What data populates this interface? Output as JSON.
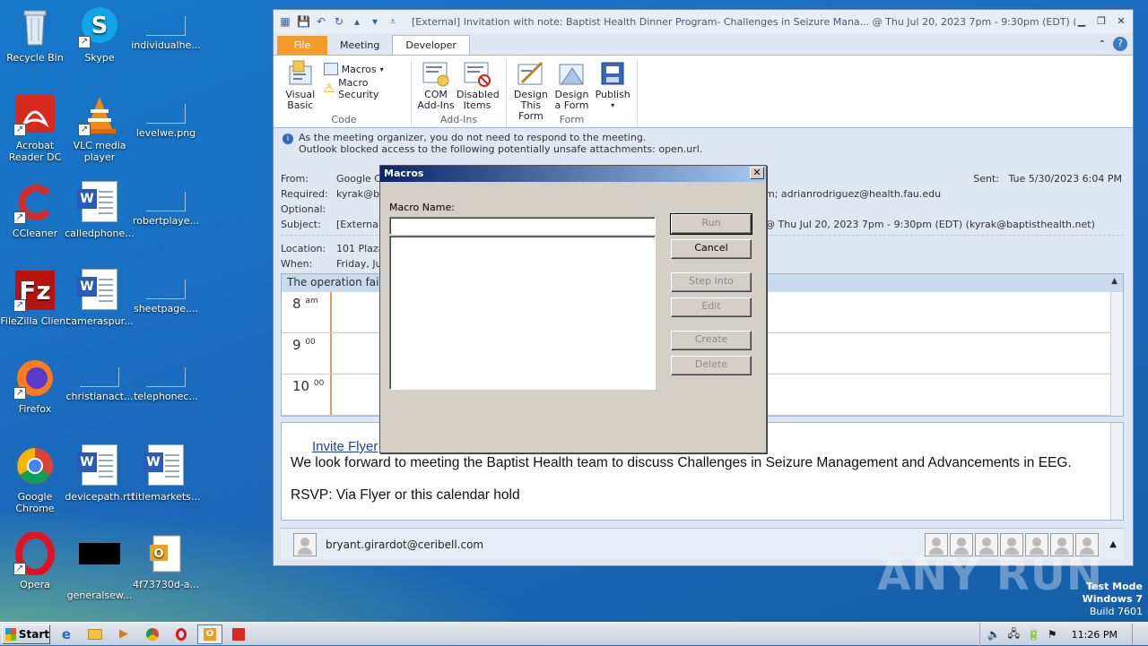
{
  "desktop": {
    "icons": [
      {
        "label": "Recycle Bin"
      },
      {
        "label": "Skype"
      },
      {
        "label": "individualhe..."
      },
      {
        "label": "Acrobat Reader DC"
      },
      {
        "label": "VLC media player"
      },
      {
        "label": "levelwe.png"
      },
      {
        "label": "CCleaner"
      },
      {
        "label": "calledphone..."
      },
      {
        "label": "robertplaye..."
      },
      {
        "label": "FileZilla Client"
      },
      {
        "label": "cameraspur..."
      },
      {
        "label": "sheetpage...."
      },
      {
        "label": "Firefox"
      },
      {
        "label": "christianact..."
      },
      {
        "label": "telephonec..."
      },
      {
        "label": "Google Chrome"
      },
      {
        "label": "devicepath.rtf"
      },
      {
        "label": "titlemarkets..."
      },
      {
        "label": "Opera"
      },
      {
        "label": "generalsew..."
      },
      {
        "label": "4f73730d-a..."
      }
    ]
  },
  "outlook": {
    "title": "[External] Invitation with note: Baptist Health Dinner Program- Challenges in Seizure Mana... @ Thu Jul 20, 2023 7pm - 9:30pm (EDT) (kyrak...",
    "tabs": {
      "file": "File",
      "meeting": "Meeting",
      "developer": "Developer"
    },
    "ribbon": {
      "visual_basic": "Visual Basic",
      "macros": "Macros",
      "macro_security": "Macro Security",
      "code_group": "Code",
      "com_addins": "COM Add-Ins",
      "disabled_items": "Disabled Items",
      "addins_group": "Add-Ins",
      "design_this_form": "Design This Form",
      "design_a_form": "Design a Form",
      "publish": "Publish",
      "form_group": "Form"
    },
    "infobar": {
      "line1": "As the meeting organizer, you do not need to respond to the meeting.",
      "line2": "Outlook blocked access to the following potentially unsafe attachments: open.url."
    },
    "header": {
      "from_label": "From:",
      "from_value": "Google Ca",
      "required_label": "Required:",
      "required_value": "kyrak@ba",
      "required_tail": "m; adrianrodriguez@health.fau.edu",
      "optional_label": "Optional:",
      "subject_label": "Subject:",
      "subject_value": "[External]",
      "subject_tail": "@ Thu Jul 20, 2023 7pm - 9:30pm (EDT) (kyrak@baptisthealth.net)",
      "location_label": "Location:",
      "location_value": "101 Plaza",
      "when_label": "When:",
      "when_value": "Friday, Ju",
      "sent_label": "Sent:",
      "sent_value": "Tue 5/30/2023 6:04 PM"
    },
    "calendar": {
      "banner": "The operation failed",
      "rows": [
        {
          "hour": "8",
          "suffix": "am"
        },
        {
          "hour": "9",
          "suffix": "00"
        },
        {
          "hour": "10",
          "suffix": "00"
        }
      ]
    },
    "body": {
      "link": "Invite Flyer",
      "para1": "We look forward to meeting the Baptist Health team to discuss Challenges in Seizure Management and Advancements in EEG.",
      "para2": "RSVP: Via Flyer or this calendar hold"
    },
    "people": {
      "email": "bryant.girardot@ceribell.com"
    }
  },
  "macros_dialog": {
    "title": "Macros",
    "close": "✕",
    "name_label": "Macro Name:",
    "name_value": "",
    "buttons": {
      "run": "Run",
      "cancel": "Cancel",
      "step_into": "Step Into",
      "edit": "Edit",
      "create": "Create",
      "delete": "Delete"
    }
  },
  "taskbar": {
    "start": "Start",
    "clock": "11:26 PM"
  },
  "watermark": "ANY RUN",
  "test_mode": {
    "line1": "Test Mode",
    "line2": "Windows 7",
    "line3": "Build 7601"
  }
}
